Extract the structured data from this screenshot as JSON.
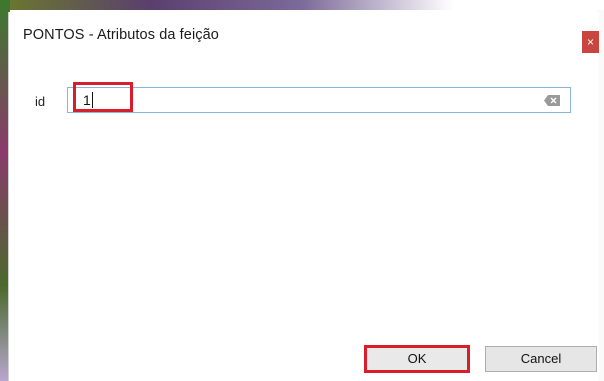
{
  "dialog": {
    "title": "PONTOS - Atributos da feição",
    "close_glyph": "×"
  },
  "form": {
    "fields": [
      {
        "label": "id",
        "value": "1"
      }
    ]
  },
  "buttons": {
    "ok_label": "OK",
    "cancel_label": "Cancel"
  },
  "icons": {
    "close": "close-icon",
    "clear": "clear-text-icon"
  },
  "colors": {
    "highlight": "#d81e2a",
    "close_button": "#c9453f",
    "input_border": "#8ab4d8"
  }
}
